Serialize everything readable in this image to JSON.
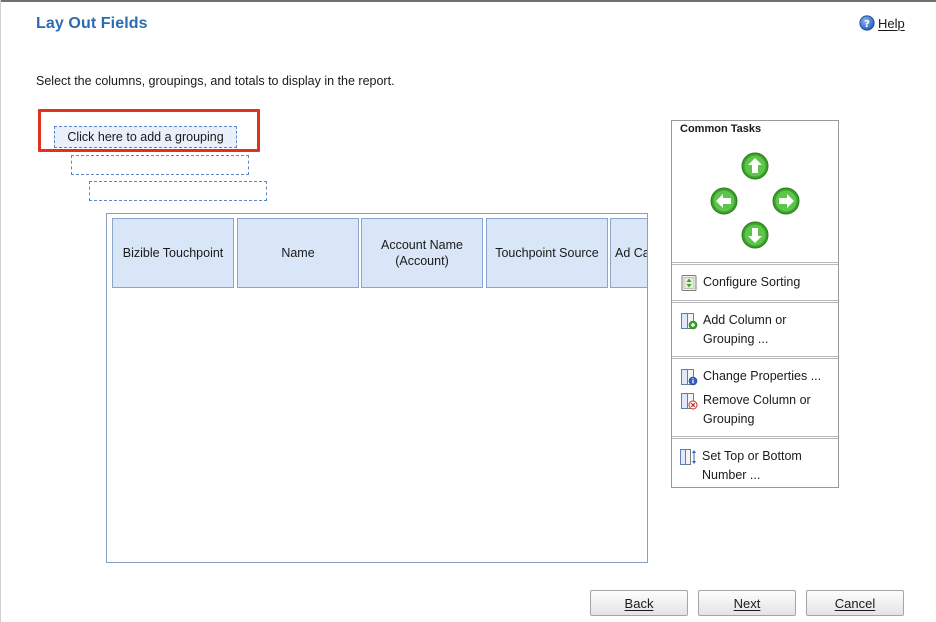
{
  "page": {
    "title": "Lay Out Fields",
    "help_label": "Help",
    "instructions": "Select the columns, groupings, and totals to display in the report."
  },
  "grouping": {
    "add_prompt": "Click here to add a grouping"
  },
  "columns": [
    {
      "label": "Bizible Touchpoint"
    },
    {
      "label": "Name"
    },
    {
      "label": "Account Name\n(Account)"
    },
    {
      "label": "Touchpoint Source"
    },
    {
      "label": "Ad Ca"
    }
  ],
  "common_tasks": {
    "title": "Common Tasks",
    "arrows": [
      "up-arrow-icon",
      "left-arrow-icon",
      "right-arrow-icon",
      "down-arrow-icon"
    ],
    "items": [
      {
        "label": "Configure Sorting",
        "icon": "sort-icon"
      },
      {
        "label": "Add Column or\nGrouping ...",
        "icon": "add-column-icon"
      },
      {
        "label": "Change Properties ...",
        "icon": "properties-icon"
      },
      {
        "label": "Remove Column or\nGrouping",
        "icon": "remove-column-icon"
      },
      {
        "label": "Set Top or Bottom\nNumber ...",
        "icon": "top-bottom-icon"
      }
    ]
  },
  "footer": {
    "back": "Back",
    "next": "Next",
    "cancel": "Cancel"
  },
  "colors": {
    "title": "#2b6cb0",
    "highlight": "#e0331f",
    "header_fill": "#d8e6f8",
    "arrow_green": "#3aa12a"
  }
}
